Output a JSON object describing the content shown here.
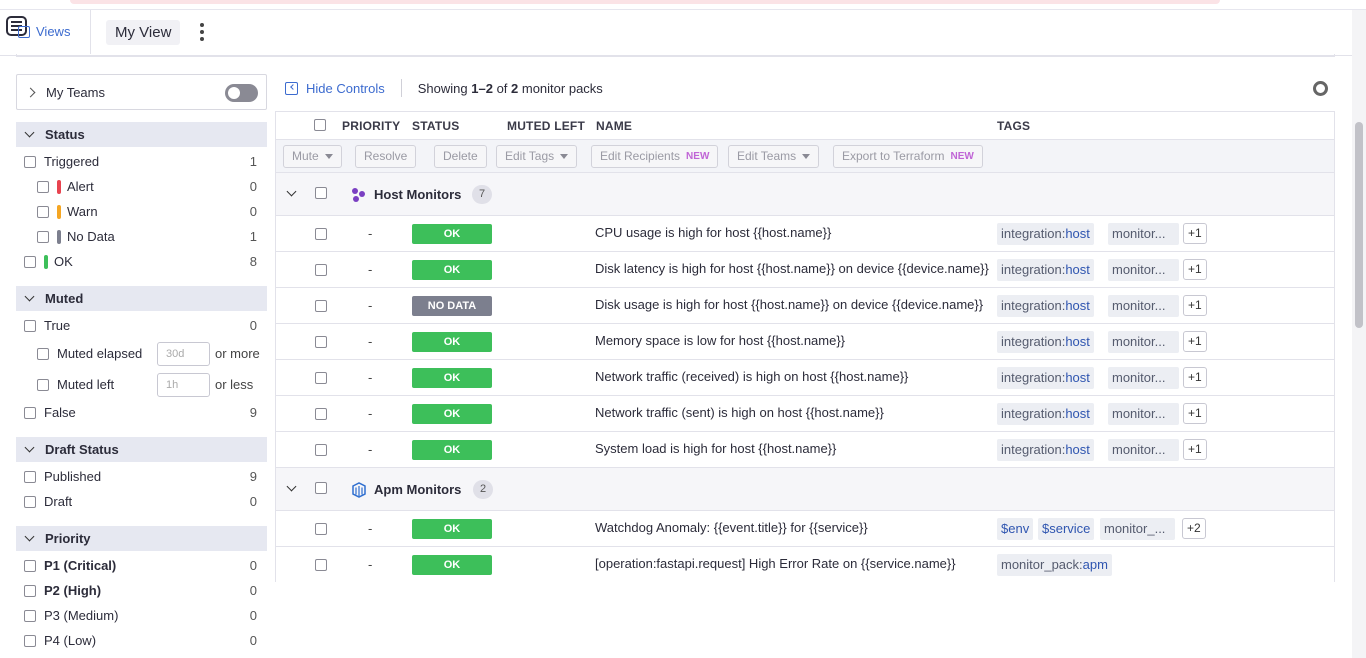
{
  "header": {
    "views_label": "Views",
    "view_name": "My View"
  },
  "sidebar": {
    "my_teams": "My Teams",
    "status": {
      "title": "Status",
      "items": [
        {
          "label": "Triggered",
          "count": "1"
        },
        {
          "label": "Alert",
          "count": "0",
          "color": "#e8434f"
        },
        {
          "label": "Warn",
          "count": "0",
          "color": "#f5a623"
        },
        {
          "label": "No Data",
          "count": "1",
          "color": "#7c7f8e"
        },
        {
          "label": "OK",
          "count": "8",
          "color": "#3dbf5a"
        }
      ]
    },
    "muted": {
      "title": "Muted",
      "true_label": "True",
      "true_count": "0",
      "muted_elapsed": "Muted elapsed",
      "elapsed_placeholder": "30d",
      "elapsed_suffix": "or more",
      "muted_left": "Muted left",
      "left_placeholder": "1h",
      "left_suffix": "or less",
      "false_label": "False",
      "false_count": "9"
    },
    "draft": {
      "title": "Draft Status",
      "items": [
        {
          "label": "Published",
          "count": "9"
        },
        {
          "label": "Draft",
          "count": "0"
        }
      ]
    },
    "priority": {
      "title": "Priority",
      "items": [
        {
          "label": "P1 (Critical)",
          "count": "0"
        },
        {
          "label": "P2 (High)",
          "count": "0"
        },
        {
          "label": "P3 (Medium)",
          "count": "0"
        },
        {
          "label": "P4 (Low)",
          "count": "0"
        }
      ]
    }
  },
  "controls": {
    "hide_label": "Hide Controls",
    "showing_prefix": "Showing ",
    "showing_range": "1–2",
    "showing_of": " of ",
    "showing_total": "2",
    "showing_suffix": " monitor packs"
  },
  "table": {
    "columns": {
      "priority": "PRIORITY",
      "status": "STATUS",
      "muted_left": "MUTED LEFT",
      "name": "NAME",
      "tags": "TAGS"
    },
    "bulk": {
      "mute": "Mute",
      "resolve": "Resolve",
      "delete": "Delete",
      "edit_tags": "Edit Tags",
      "edit_recipients": "Edit Recipients",
      "edit_teams": "Edit Teams",
      "export": "Export to Terraform",
      "new_badge": "NEW"
    },
    "groups": [
      {
        "name": "Host Monitors",
        "count": "7",
        "rows": [
          {
            "priority": "-",
            "status": "OK",
            "name": "CPU usage is high for host {{host.name}}",
            "tag1_key": "integration:",
            "tag1_val": "host",
            "tag2": "monitor...",
            "more": "+1"
          },
          {
            "priority": "-",
            "status": "OK",
            "name": "Disk latency is high for host {{host.name}} on device {{device.name}}",
            "tag1_key": "integration:",
            "tag1_val": "host",
            "tag2": "monitor...",
            "more": "+1"
          },
          {
            "priority": "-",
            "status": "NO DATA",
            "name": "Disk usage is high for host {{host.name}} on device {{device.name}}",
            "tag1_key": "integration:",
            "tag1_val": "host",
            "tag2": "monitor...",
            "more": "+1"
          },
          {
            "priority": "-",
            "status": "OK",
            "name": "Memory space is low for host {{host.name}}",
            "tag1_key": "integration:",
            "tag1_val": "host",
            "tag2": "monitor...",
            "more": "+1"
          },
          {
            "priority": "-",
            "status": "OK",
            "name": "Network traffic (received) is high on host {{host.name}}",
            "tag1_key": "integration:",
            "tag1_val": "host",
            "tag2": "monitor...",
            "more": "+1"
          },
          {
            "priority": "-",
            "status": "OK",
            "name": "Network traffic (sent) is high on host {{host.name}}",
            "tag1_key": "integration:",
            "tag1_val": "host",
            "tag2": "monitor...",
            "more": "+1"
          },
          {
            "priority": "-",
            "status": "OK",
            "name": "System load is high for host {{host.name}}",
            "tag1_key": "integration:",
            "tag1_val": "host",
            "tag2": "monitor...",
            "more": "+1"
          }
        ]
      },
      {
        "name": "Apm Monitors",
        "count": "2",
        "rows": [
          {
            "priority": "-",
            "status": "OK",
            "name": "Watchdog Anomaly: {{event.title}} for {{service}}",
            "tag_a": "$env",
            "tag_b": "$service",
            "tag_c": "monitor_...",
            "more": "+2"
          },
          {
            "priority": "-",
            "status": "OK",
            "name": "[operation:fastapi.request] High Error Rate on {{service.name}}",
            "tag1_key": "monitor_pack:",
            "tag1_val": "apm"
          }
        ]
      }
    ]
  },
  "colors": {
    "accent": "#3c6bcf",
    "ok": "#3dbf5a",
    "no_data": "#7c7f8e"
  }
}
